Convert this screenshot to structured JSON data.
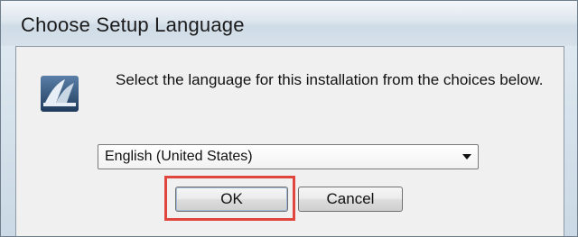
{
  "window": {
    "title": "Choose Setup Language"
  },
  "dialog": {
    "prompt": "Select the language for this installation from the choices below.",
    "app_icon": "setup-installer-icon",
    "language_select": {
      "selected": "English (United States)",
      "arrow_icon": "chevron-down-icon"
    },
    "buttons": {
      "ok": "OK",
      "cancel": "Cancel"
    }
  },
  "annotation": {
    "highlight_color": "#e0463d",
    "highlight_target": "ok-button"
  }
}
